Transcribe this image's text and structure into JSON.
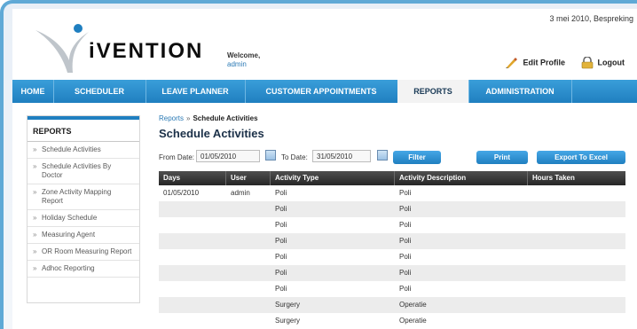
{
  "date_line": "3 mei 2010, Bespreking",
  "logo_text": "iVENTION",
  "welcome": {
    "label": "Welcome,",
    "user": "admin"
  },
  "top_actions": {
    "edit_profile": "Edit Profile",
    "logout": "Logout"
  },
  "nav": {
    "tabs": [
      {
        "label": "HOME"
      },
      {
        "label": "SCHEDULER"
      },
      {
        "label": "LEAVE PLANNER"
      },
      {
        "label": "CUSTOMER APPOINTMENTS"
      },
      {
        "label": "REPORTS"
      },
      {
        "label": "ADMINISTRATION"
      }
    ],
    "active": "REPORTS"
  },
  "sidebar": {
    "title": "REPORTS",
    "items": [
      {
        "label": "Schedule Activities"
      },
      {
        "label": "Schedule Activities By Doctor"
      },
      {
        "label": "Zone Activity Mapping Report"
      },
      {
        "label": "Holiday Schedule"
      },
      {
        "label": "Measuring Agent"
      },
      {
        "label": "OR Room Measuring Report"
      },
      {
        "label": "Adhoc Reporting"
      }
    ]
  },
  "breadcrumb": {
    "parent": "Reports",
    "separator": "»",
    "current": "Schedule Activities"
  },
  "page_title": "Schedule Activities",
  "filters": {
    "from_label": "From Date:",
    "from_value": "01/05/2010",
    "to_label": "To Date:",
    "to_value": "31/05/2010",
    "filter_button": "Filter",
    "print_button": "Print",
    "export_button": "Export To Excel"
  },
  "table": {
    "columns": [
      "Days",
      "User",
      "Activity Type",
      "Activity Description",
      "Hours Taken"
    ],
    "rows": [
      [
        "01/05/2010",
        "admin",
        "Poli",
        "Poli",
        ""
      ],
      [
        "",
        "",
        "Poli",
        "Poli",
        ""
      ],
      [
        "",
        "",
        "Poli",
        "Poli",
        ""
      ],
      [
        "",
        "",
        "Poli",
        "Poli",
        ""
      ],
      [
        "",
        "",
        "Poli",
        "Poli",
        ""
      ],
      [
        "",
        "",
        "Poli",
        "Poli",
        ""
      ],
      [
        "",
        "",
        "Poli",
        "Poli",
        ""
      ],
      [
        "",
        "",
        "Surgery",
        "Operatie",
        ""
      ],
      [
        "",
        "",
        "Surgery",
        "Operatie",
        ""
      ]
    ]
  },
  "colors": {
    "accent": "#1f7fc0",
    "header_dark": "#2a2a2a",
    "frame_border": "#5fa9d6"
  }
}
